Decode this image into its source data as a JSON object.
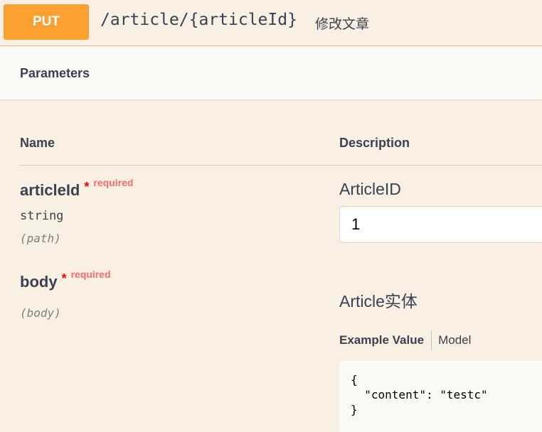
{
  "endpoint": {
    "method": "PUT",
    "path": "/article/{articleId}",
    "summary": "修改文章"
  },
  "parameters_section": {
    "title": "Parameters",
    "col_name": "Name",
    "col_description": "Description"
  },
  "params": [
    {
      "name": "articleId",
      "star": "*",
      "required_label": "required",
      "type": "string",
      "in": "(path)",
      "description": "ArticleID",
      "value": "1"
    },
    {
      "name": "body",
      "star": "*",
      "required_label": "required",
      "in": "(body)",
      "description": "Article实体",
      "tab_example": "Example Value",
      "tab_model": "Model",
      "example": "{\n  \"content\": \"testc\"\n}"
    }
  ],
  "colors": {
    "method_badge": "#fca130",
    "background": "#f9efe3",
    "required": "#ff6b6b"
  }
}
